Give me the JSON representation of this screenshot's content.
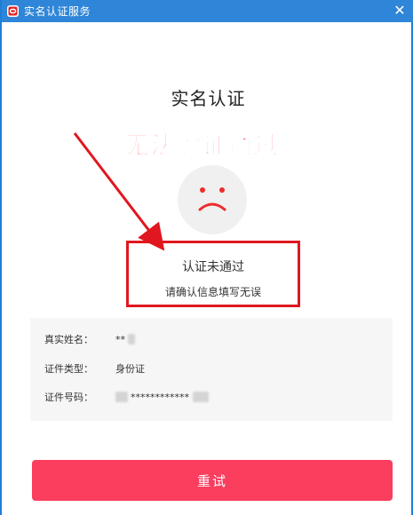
{
  "window": {
    "title": "实名认证服务",
    "close_glyph": "✕"
  },
  "heading": "实名认证",
  "annotation": "无法验证通过",
  "result": {
    "title": "认证未通过",
    "subtitle": "请确认信息填写无误"
  },
  "info": {
    "name_label": "真实姓名：",
    "name_value": "**",
    "id_type_label": "证件类型：",
    "id_type_value": "身份证",
    "id_number_label": "证件号码：",
    "id_number_value": "************"
  },
  "retry_button": "重试",
  "colors": {
    "titlebar": "#2f86d8",
    "annotation_red": "#ff1f2d",
    "button": "#fb3d5e"
  }
}
